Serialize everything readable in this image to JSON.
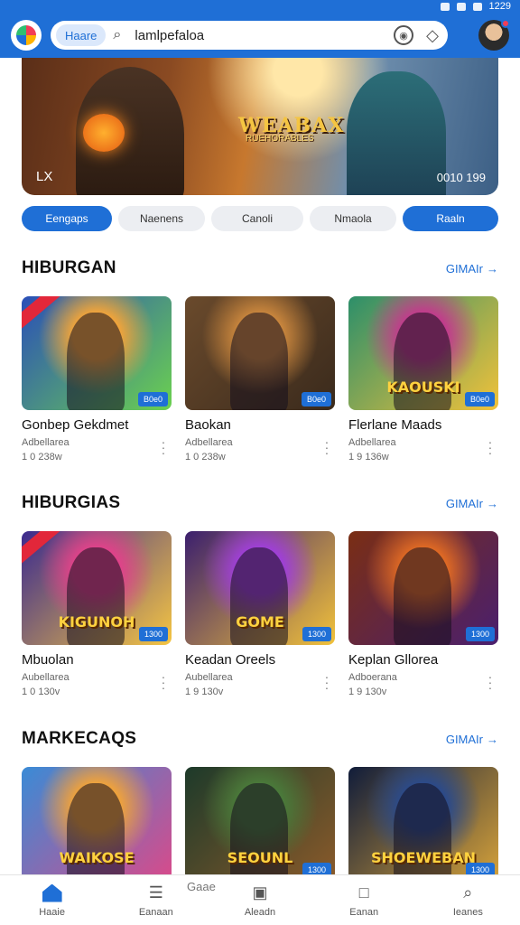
{
  "status": {
    "time": "1229"
  },
  "header": {
    "pill": "Haare",
    "search_text": "lamlpefaloa"
  },
  "hero": {
    "title": "WEABAX",
    "subtitle": "RUEHORABLES",
    "left_label": "LX",
    "right_label": "0010 199"
  },
  "chips": [
    {
      "label": "Eengaps",
      "active": true
    },
    {
      "label": "Naenens",
      "active": false
    },
    {
      "label": "Canoli",
      "active": false
    },
    {
      "label": "Nmaola",
      "active": false
    },
    {
      "label": "Raaln",
      "active": true
    }
  ],
  "sections": [
    {
      "title": "HIBURGAN",
      "link": "GIMAIr",
      "cards": [
        {
          "title": "Gonbep  Gekdmet",
          "sub": "Adbellarea",
          "size": "1 0 238w",
          "tag": "B0e0",
          "art": ""
        },
        {
          "title": "Baokan",
          "sub": "Adbellarea",
          "size": "1 0 238w",
          "tag": "B0e0",
          "art": ""
        },
        {
          "title": "Flerlane Maads",
          "sub": "Adbellarea",
          "size": "1 9 136w",
          "tag": "B0e0",
          "art": "KAOUSKI"
        }
      ]
    },
    {
      "title": "HIBURGIAS",
      "link": "GIMAIr",
      "cards": [
        {
          "title": "Mbuolan",
          "sub": "Aubellarea",
          "size": "1 0 130v",
          "tag": "1300",
          "art": "KIGUNOH"
        },
        {
          "title": "Keadan Oreels",
          "sub": "Aubellarea",
          "size": "1 9 130v",
          "tag": "1300",
          "art": "GOME"
        },
        {
          "title": "Keplan Gllorea",
          "sub": "Adboerana",
          "size": "1 9 130v",
          "tag": "1300",
          "art": ""
        }
      ]
    },
    {
      "title": "MARKECAQS",
      "link": "GIMAIr",
      "cards": [
        {
          "title": "",
          "sub": "",
          "size": "",
          "tag": "",
          "art": "WAIKOSE"
        },
        {
          "title": "",
          "sub": "",
          "size": "",
          "tag": "1300",
          "art": "SEOUNL"
        },
        {
          "title": "",
          "sub": "",
          "size": "",
          "tag": "1300",
          "art": "SHOEWEBAN"
        }
      ]
    }
  ],
  "thumb_colors": [
    [
      "#2a4fb8",
      "#f2a43a",
      "#6bd14f"
    ],
    [
      "#6a4a2c",
      "#c9863d",
      "#3a2a1c"
    ],
    [
      "#2c8f6a",
      "#c23a8d",
      "#f2c23a"
    ],
    [
      "#3b2a8f",
      "#e0428a",
      "#f5c542"
    ],
    [
      "#3b1f6e",
      "#9f3fd8",
      "#f2c23a"
    ],
    [
      "#7a2e14",
      "#e06a24",
      "#4a1f6e"
    ],
    [
      "#3a8bd6",
      "#f0a33a",
      "#d94a8a"
    ],
    [
      "#1d3a2a",
      "#4a7a3a",
      "#8a5a2a"
    ],
    [
      "#101c3a",
      "#2b4a8a",
      "#d6a23a"
    ]
  ],
  "bottom_nav": {
    "floating": "Gaae",
    "items": [
      {
        "label": "Haaie",
        "icon": "home-icon",
        "active": true
      },
      {
        "label": "Eanaan",
        "icon": "menu-icon",
        "active": false
      },
      {
        "label": "Aleadn",
        "icon": "library-icon",
        "active": false
      },
      {
        "label": "Eanan",
        "icon": "tablet-icon",
        "active": false
      },
      {
        "label": "Ieanes",
        "icon": "search-icon",
        "active": false
      }
    ]
  }
}
